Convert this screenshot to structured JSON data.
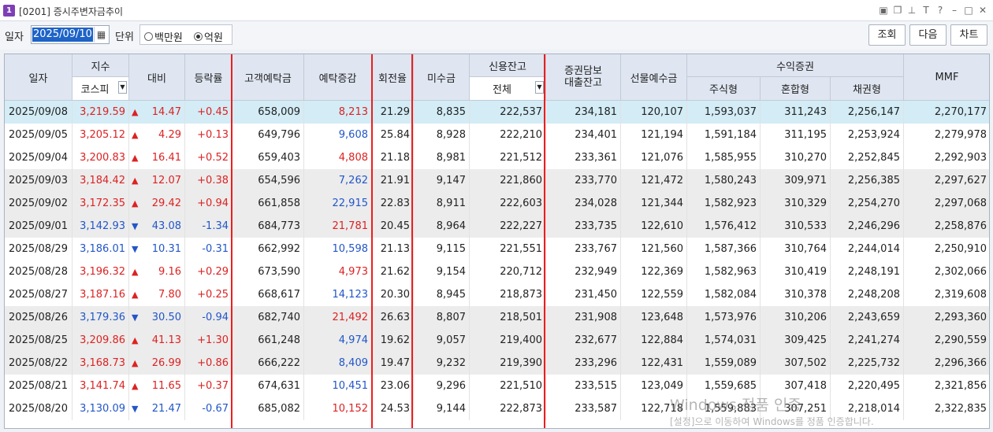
{
  "window": {
    "icon_label": "1",
    "title": "[0201] 증시주변자금추이",
    "title_icons": [
      "window-layout-icon",
      "window-copy-icon",
      "pin-icon",
      "font-icon",
      "help-icon",
      "minimize-icon",
      "maximize-icon",
      "close-icon"
    ]
  },
  "toolbar": {
    "date_label": "일자",
    "date_value": "2025/09/10",
    "unit_label": "단위",
    "unit_options": [
      "백만원",
      "억원"
    ],
    "unit_selected": "억원",
    "buttons": [
      "조회",
      "다음",
      "차트"
    ]
  },
  "headers": {
    "date": "일자",
    "index": "지수",
    "index_select": "코스피",
    "change": "대비",
    "rate": "등락률",
    "deposit": "고객예탁금",
    "deposit_change": "예탁증감",
    "turnover": "회전율",
    "unsettled": "미수금",
    "credit": "신용잔고",
    "credit_select": "전체",
    "collateral": "증권담보\n대출잔고",
    "futures": "선물예수금",
    "beneficiary": "수익증권",
    "stock_type": "주식형",
    "mixed_type": "혼합형",
    "bond_type": "채권형",
    "mmf": "MMF"
  },
  "rows": [
    {
      "date": "2025/09/08",
      "index": "3,219.59",
      "dir": "up",
      "change": "14.47",
      "rate": "+0.45",
      "deposit": "658,009",
      "deposit_change": "8,213",
      "dc_dir": "up",
      "turnover": "21.29",
      "unsettled": "8,835",
      "credit": "222,537",
      "collateral": "234,181",
      "futures": "120,107",
      "stock": "1,593,037",
      "mixed": "311,243",
      "bond": "2,256,147",
      "mmf": "2,270,177"
    },
    {
      "date": "2025/09/05",
      "index": "3,205.12",
      "dir": "up",
      "change": "4.29",
      "rate": "+0.13",
      "deposit": "649,796",
      "deposit_change": "9,608",
      "dc_dir": "down",
      "turnover": "25.84",
      "unsettled": "8,928",
      "credit": "222,210",
      "collateral": "234,401",
      "futures": "121,194",
      "stock": "1,591,184",
      "mixed": "311,195",
      "bond": "2,253,924",
      "mmf": "2,279,978"
    },
    {
      "date": "2025/09/04",
      "index": "3,200.83",
      "dir": "up",
      "change": "16.41",
      "rate": "+0.52",
      "deposit": "659,403",
      "deposit_change": "4,808",
      "dc_dir": "up",
      "turnover": "21.18",
      "unsettled": "8,981",
      "credit": "221,512",
      "collateral": "233,361",
      "futures": "121,076",
      "stock": "1,585,955",
      "mixed": "310,270",
      "bond": "2,252,845",
      "mmf": "2,292,903"
    },
    {
      "date": "2025/09/03",
      "index": "3,184.42",
      "dir": "up",
      "change": "12.07",
      "rate": "+0.38",
      "deposit": "654,596",
      "deposit_change": "7,262",
      "dc_dir": "down",
      "turnover": "21.91",
      "unsettled": "9,147",
      "credit": "221,860",
      "collateral": "233,770",
      "futures": "121,472",
      "stock": "1,580,243",
      "mixed": "309,971",
      "bond": "2,256,385",
      "mmf": "2,297,627"
    },
    {
      "date": "2025/09/02",
      "index": "3,172.35",
      "dir": "up",
      "change": "29.42",
      "rate": "+0.94",
      "deposit": "661,858",
      "deposit_change": "22,915",
      "dc_dir": "down",
      "turnover": "22.83",
      "unsettled": "8,911",
      "credit": "222,603",
      "collateral": "234,028",
      "futures": "121,344",
      "stock": "1,582,923",
      "mixed": "310,329",
      "bond": "2,254,270",
      "mmf": "2,297,068"
    },
    {
      "date": "2025/09/01",
      "index": "3,142.93",
      "dir": "down",
      "change": "43.08",
      "rate": "-1.34",
      "deposit": "684,773",
      "deposit_change": "21,781",
      "dc_dir": "up",
      "turnover": "20.45",
      "unsettled": "8,964",
      "credit": "222,227",
      "collateral": "233,735",
      "futures": "122,610",
      "stock": "1,576,412",
      "mixed": "310,533",
      "bond": "2,246,296",
      "mmf": "2,258,876"
    },
    {
      "date": "2025/08/29",
      "index": "3,186.01",
      "dir": "down",
      "change": "10.31",
      "rate": "-0.31",
      "deposit": "662,992",
      "deposit_change": "10,598",
      "dc_dir": "down",
      "turnover": "21.13",
      "unsettled": "9,115",
      "credit": "221,551",
      "collateral": "233,767",
      "futures": "121,560",
      "stock": "1,587,366",
      "mixed": "310,764",
      "bond": "2,244,014",
      "mmf": "2,250,910"
    },
    {
      "date": "2025/08/28",
      "index": "3,196.32",
      "dir": "up",
      "change": "9.16",
      "rate": "+0.29",
      "deposit": "673,590",
      "deposit_change": "4,973",
      "dc_dir": "up",
      "turnover": "21.62",
      "unsettled": "9,154",
      "credit": "220,712",
      "collateral": "232,949",
      "futures": "122,369",
      "stock": "1,582,963",
      "mixed": "310,419",
      "bond": "2,248,191",
      "mmf": "2,302,066"
    },
    {
      "date": "2025/08/27",
      "index": "3,187.16",
      "dir": "up",
      "change": "7.80",
      "rate": "+0.25",
      "deposit": "668,617",
      "deposit_change": "14,123",
      "dc_dir": "down",
      "turnover": "20.30",
      "unsettled": "8,945",
      "credit": "218,873",
      "collateral": "231,450",
      "futures": "122,559",
      "stock": "1,582,084",
      "mixed": "310,378",
      "bond": "2,248,208",
      "mmf": "2,319,608"
    },
    {
      "date": "2025/08/26",
      "index": "3,179.36",
      "dir": "down",
      "change": "30.50",
      "rate": "-0.94",
      "deposit": "682,740",
      "deposit_change": "21,492",
      "dc_dir": "up",
      "turnover": "26.63",
      "unsettled": "8,807",
      "credit": "218,501",
      "collateral": "231,908",
      "futures": "123,648",
      "stock": "1,573,976",
      "mixed": "310,206",
      "bond": "2,243,659",
      "mmf": "2,293,360"
    },
    {
      "date": "2025/08/25",
      "index": "3,209.86",
      "dir": "up",
      "change": "41.13",
      "rate": "+1.30",
      "deposit": "661,248",
      "deposit_change": "4,974",
      "dc_dir": "down",
      "turnover": "19.62",
      "unsettled": "9,057",
      "credit": "219,400",
      "collateral": "232,677",
      "futures": "122,884",
      "stock": "1,574,031",
      "mixed": "309,425",
      "bond": "2,241,274",
      "mmf": "2,290,559"
    },
    {
      "date": "2025/08/22",
      "index": "3,168.73",
      "dir": "up",
      "change": "26.99",
      "rate": "+0.86",
      "deposit": "666,222",
      "deposit_change": "8,409",
      "dc_dir": "down",
      "turnover": "19.47",
      "unsettled": "9,232",
      "credit": "219,390",
      "collateral": "233,296",
      "futures": "122,431",
      "stock": "1,559,089",
      "mixed": "307,502",
      "bond": "2,225,732",
      "mmf": "2,296,366"
    },
    {
      "date": "2025/08/21",
      "index": "3,141.74",
      "dir": "up",
      "change": "11.65",
      "rate": "+0.37",
      "deposit": "674,631",
      "deposit_change": "10,451",
      "dc_dir": "down",
      "turnover": "23.06",
      "unsettled": "9,296",
      "credit": "221,510",
      "collateral": "233,515",
      "futures": "123,049",
      "stock": "1,559,685",
      "mixed": "307,418",
      "bond": "2,220,495",
      "mmf": "2,321,856"
    },
    {
      "date": "2025/08/20",
      "index": "3,130.09",
      "dir": "down",
      "change": "21.47",
      "rate": "-0.67",
      "deposit": "685,082",
      "deposit_change": "10,152",
      "dc_dir": "up",
      "turnover": "24.53",
      "unsettled": "9,144",
      "credit": "222,873",
      "collateral": "233,587",
      "futures": "122,718",
      "stock": "1,559,883",
      "mixed": "307,251",
      "bond": "2,218,014",
      "mmf": "2,322,835"
    }
  ],
  "watermark": {
    "line1": "Windows 정품 인증",
    "line2": "[설정]으로 이동하여 Windows를 정품 인증합니다."
  },
  "colors": {
    "up": "#d22222",
    "down": "#2256c9",
    "highlight_box": "#ee1d1d",
    "selected_row": "#d3ecf6",
    "header_bg": "#dfe6f1"
  }
}
